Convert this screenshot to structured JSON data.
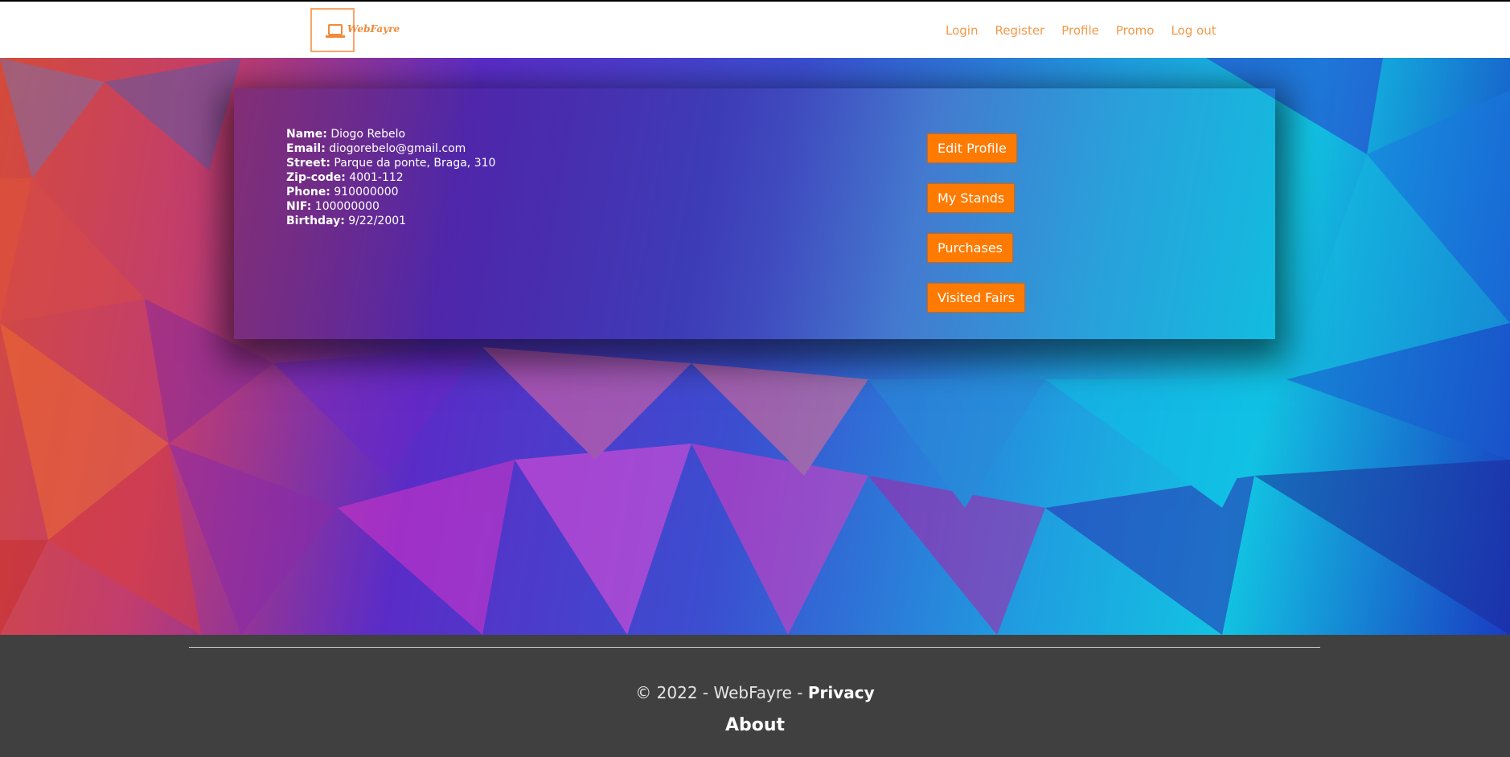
{
  "brand": {
    "logo_text": "WebFayre"
  },
  "nav": {
    "items": [
      {
        "label": "Login"
      },
      {
        "label": "Register"
      },
      {
        "label": "Profile"
      },
      {
        "label": "Promo"
      },
      {
        "label": "Log out"
      }
    ]
  },
  "profile": {
    "fields": [
      {
        "label": "Name:",
        "value": "Diogo Rebelo"
      },
      {
        "label": "Email:",
        "value": "diogorebelo@gmail.com"
      },
      {
        "label": "Street:",
        "value": "Parque da ponte, Braga, 310"
      },
      {
        "label": "Zip-code:",
        "value": "4001-112"
      },
      {
        "label": "Phone:",
        "value": "910000000"
      },
      {
        "label": "NIF:",
        "value": "100000000"
      },
      {
        "label": "Birthday:",
        "value": "9/22/2001"
      }
    ],
    "actions": [
      {
        "label": "Edit Profile"
      },
      {
        "label": "My Stands"
      },
      {
        "label": "Purchases"
      },
      {
        "label": "Visited Fairs"
      }
    ]
  },
  "footer": {
    "copyright": "© 2022 - WebFayre - ",
    "privacy": "Privacy",
    "about": "About"
  },
  "colors": {
    "accent": "#ff7a00",
    "nav_link": "#f39a4a",
    "footer_bg": "#404040"
  }
}
